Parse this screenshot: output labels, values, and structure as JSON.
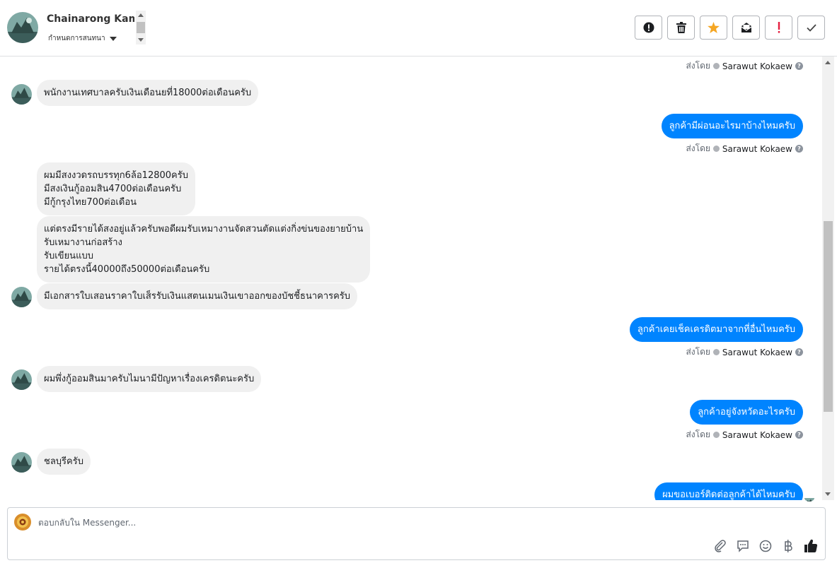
{
  "header": {
    "contact_name": "Chainarong Kamon",
    "status_label": "กำหนดการสนทนา",
    "actions": [
      {
        "name": "report-button",
        "icon": "exclamation-circle-icon"
      },
      {
        "name": "delete-button",
        "icon": "trash-icon"
      },
      {
        "name": "star-button",
        "icon": "star-icon"
      },
      {
        "name": "mark-unread-button",
        "icon": "envelope-open-icon"
      },
      {
        "name": "important-button",
        "icon": "exclamation-icon"
      },
      {
        "name": "done-button",
        "icon": "checkmark-icon"
      }
    ]
  },
  "sent_by": {
    "prefix": "ส่งโดย",
    "agent": "Sarawut Kokaew",
    "help": "?"
  },
  "messages": {
    "in1": "พนักงานเทศบาลครับเงินเดือนยที่18000ต่อเดือนครับ",
    "out1": "ลูกค้ามีผ่อนอะไรมาบ้างไหมครับ",
    "in2": [
      "ผมมีสงงวดรถบรรทุก6ล้อ12800ครับ",
      "มีสงเงินกู้ออมสิน4700ต่อเดือนครับ",
      "มีกู้กรุงไทย700ต่อเดือน"
    ],
    "in3": [
      "แต่ตรงมีรายได้สงอยู่แล้วครับพอดีผมรับเหมางานจัดสวนตัดแต่งกิ่งข่นของยายบ้าน",
      "รับเหมางานก่อสร้าง",
      "รับเขียนแบบ",
      "รายได้ตรงนี้40000ถึง50000ต่อเดือนครับ"
    ],
    "in4": "มีเอกสารใบเสอนราคาใบเส็รรับเงินแสตนเมนเงินเขาออกของบัชชี้ธนาคารครับ",
    "out2": "ลูกค้าเคยเช็คเครดิตมาจากที่อื่นไหมครับ",
    "in5": "ผมพึ่งกู้ออมสินมาครับไมนามีปัญหาเรื่องเครดิตนะครับ",
    "out3": "ลูกค้าอยู่จังหวัดอะไรครับ",
    "in6": "ชลบุรีครับ",
    "out4": "ผมขอเบอร์ติดต่อลูกค้าได้ไหมครับ"
  },
  "composer": {
    "placeholder": "ตอบกลับใน Messenger...",
    "tools": [
      "attach-icon",
      "saved-reply-icon",
      "emoji-icon",
      "baht-icon",
      "like-icon"
    ]
  },
  "colors": {
    "outgoing_bubble": "#0084ff",
    "incoming_bubble": "#f0f0f0",
    "star": "#f5a623",
    "important": "#e41e3f"
  }
}
